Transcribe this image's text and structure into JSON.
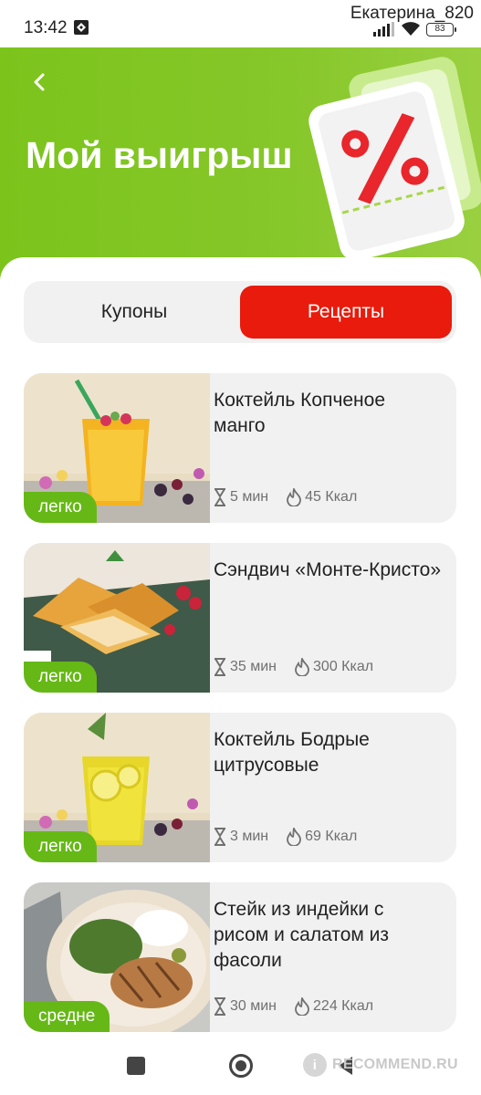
{
  "status": {
    "time": "13:42",
    "user": "Екатерина_820",
    "battery": "83"
  },
  "header": {
    "title": "Мой выигрыш"
  },
  "tabs": {
    "coupons": "Купоны",
    "recipes": "Рецепты",
    "active": "recipes"
  },
  "recipes": [
    {
      "title": "Коктейль Копченое манго",
      "difficulty": "легко",
      "time": "5 мин",
      "kcal": "45 Ккал"
    },
    {
      "title": "Сэндвич «Монте-Кристо»",
      "difficulty": "легко",
      "time": "35 мин",
      "kcal": "300 Ккал"
    },
    {
      "title": "Коктейль Бодрые цитрусовые",
      "difficulty": "легко",
      "time": "3 мин",
      "kcal": "69 Ккал"
    },
    {
      "title": "Стейк из индейки с рисом и салатом из фасоли",
      "difficulty": "средне",
      "time": "30 мин",
      "kcal": "224 Ккал"
    }
  ],
  "watermark": {
    "logo": "i",
    "text": "RECOMMEND.RU"
  },
  "colors": {
    "header_green": "#7cc41c",
    "accent_red": "#e81b0c",
    "badge_green": "#66b816",
    "card_bg": "#f1f1f1"
  },
  "icons": {
    "back": "chevron-left-icon",
    "time": "hourglass-icon",
    "calories": "flame-icon",
    "coupon": "percent-coupon-icon"
  }
}
